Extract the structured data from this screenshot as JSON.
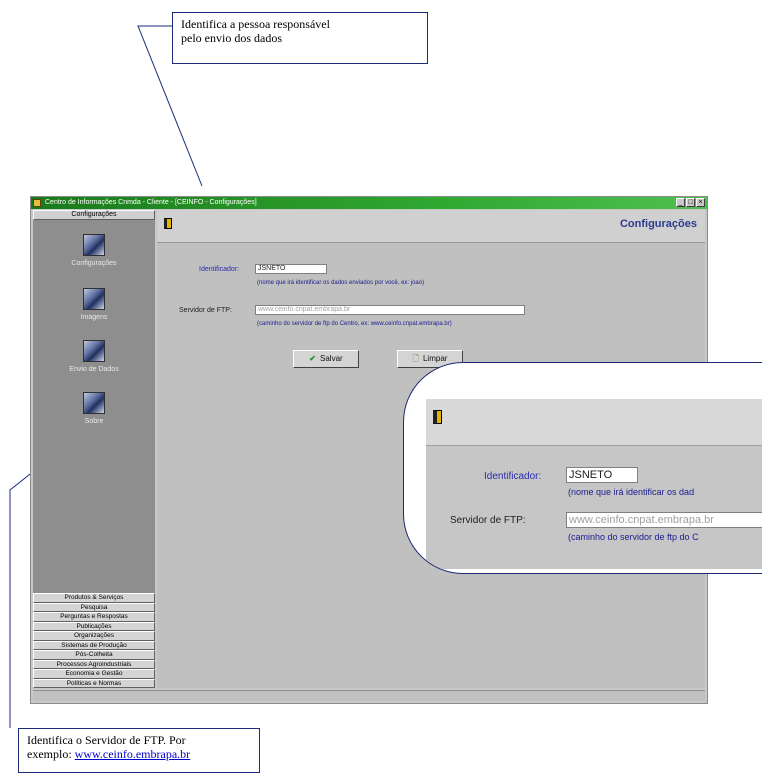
{
  "callouts": {
    "top_line1": "Identifica a pessoa responsável",
    "top_line2": "pelo envio dos dados",
    "bottom_text": "Identifica o Servidor de FTP. Por",
    "bottom_prefix": "exemplo: ",
    "bottom_link": "www.ceinfo.embrapa.br"
  },
  "window": {
    "title": "Centro de Informações Cnmda - Cliente - [CEINFO - Configurações]",
    "controls": [
      "_",
      "□",
      "×"
    ]
  },
  "sidebar": {
    "header": "Configurações",
    "icon_items": [
      {
        "label": "Configurações",
        "icon": "monitor-icon"
      },
      {
        "label": "Imagens",
        "icon": "monitor-icon"
      },
      {
        "label": "Envio de Dados",
        "icon": "monitor-icon"
      },
      {
        "label": "Sobre",
        "icon": "monitor-icon"
      }
    ],
    "tabs": [
      "Produtos & Serviços",
      "Pesquisa",
      "Perguntas e Respostas",
      "Publicações",
      "Organizações",
      "Sistemas de Produção",
      "Pós-Colheita",
      "Processos Agroindustriais",
      "Economia e Gestão",
      "Políticas e Normas"
    ]
  },
  "content": {
    "title": "Configurações",
    "identificador_label": "Identificador:",
    "identificador_value": "JSNETO",
    "identificador_hint": "(nome que irá identificar os dados enviados por você, ex: joao)",
    "ftp_label": "Servidor de FTP:",
    "ftp_value": "www.ceinfo.cnpat.embrapa.br",
    "ftp_hint": "(caminho do servidor de ftp do Centro, ex: www.ceinfo.cnpat.embrapa.br)",
    "save_button": "Salvar",
    "clear_button": "Limpar"
  },
  "zoom": {
    "identificador_label": "Identificador:",
    "identificador_value": "JSNETO",
    "identificador_hint": "(nome que irá identificar os dad",
    "ftp_label": "Servidor de FTP:",
    "ftp_value": "www.ceinfo.cnpat.embrapa.br",
    "ftp_hint": "(caminho do servidor de ftp do C"
  },
  "colors": {
    "titlebar": "#1a7a1a",
    "sidebar": "#8e8e8e",
    "panel": "#c0c0c0",
    "callout_border": "#1c2a7a",
    "label_blue": "#2a2ab0"
  }
}
